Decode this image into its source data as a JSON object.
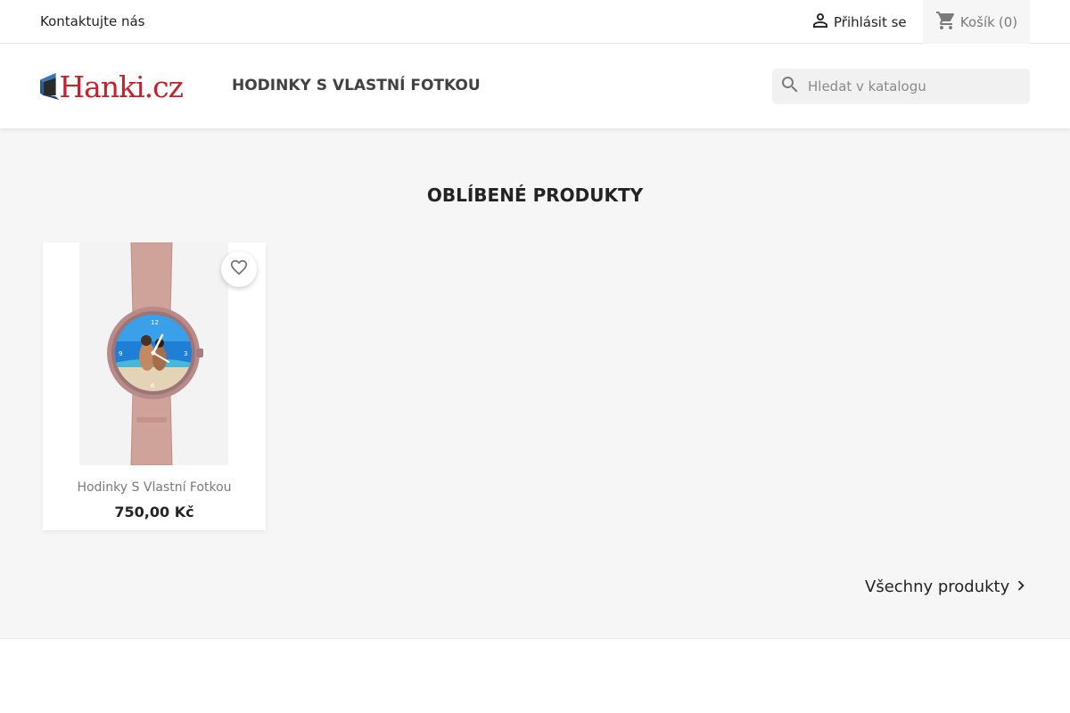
{
  "topbar": {
    "contact_label": "Kontaktujte nás",
    "signin_label": "Přihlásit se",
    "signin_icon": "person-icon",
    "cart_label": "Košík",
    "cart_count": "(0)",
    "cart_icon": "shopping-cart-icon"
  },
  "header": {
    "logo_text": "Hanki.cz",
    "nav_item": "HODINKY S VLASTNÍ FOTKOU",
    "search": {
      "placeholder": "Hledat v katalogu",
      "value": "",
      "icon": "search-icon"
    }
  },
  "main": {
    "section_title": "OBLÍBENÉ PRODUKTY",
    "products": [
      {
        "name": "Hodinky S Vlastní Fotkou",
        "price": "750,00 Kč",
        "image": "watch-photo-image",
        "wishlist_icon": "heart-outline-icon"
      }
    ],
    "all_products_label": "Všechny produkty",
    "all_products_icon": "chevron-right-icon"
  },
  "colors": {
    "brand_red": "#c8202a",
    "brand_blue": "#1f5a99",
    "text_dark": "#232323",
    "text_muted": "#7a7a7a"
  }
}
